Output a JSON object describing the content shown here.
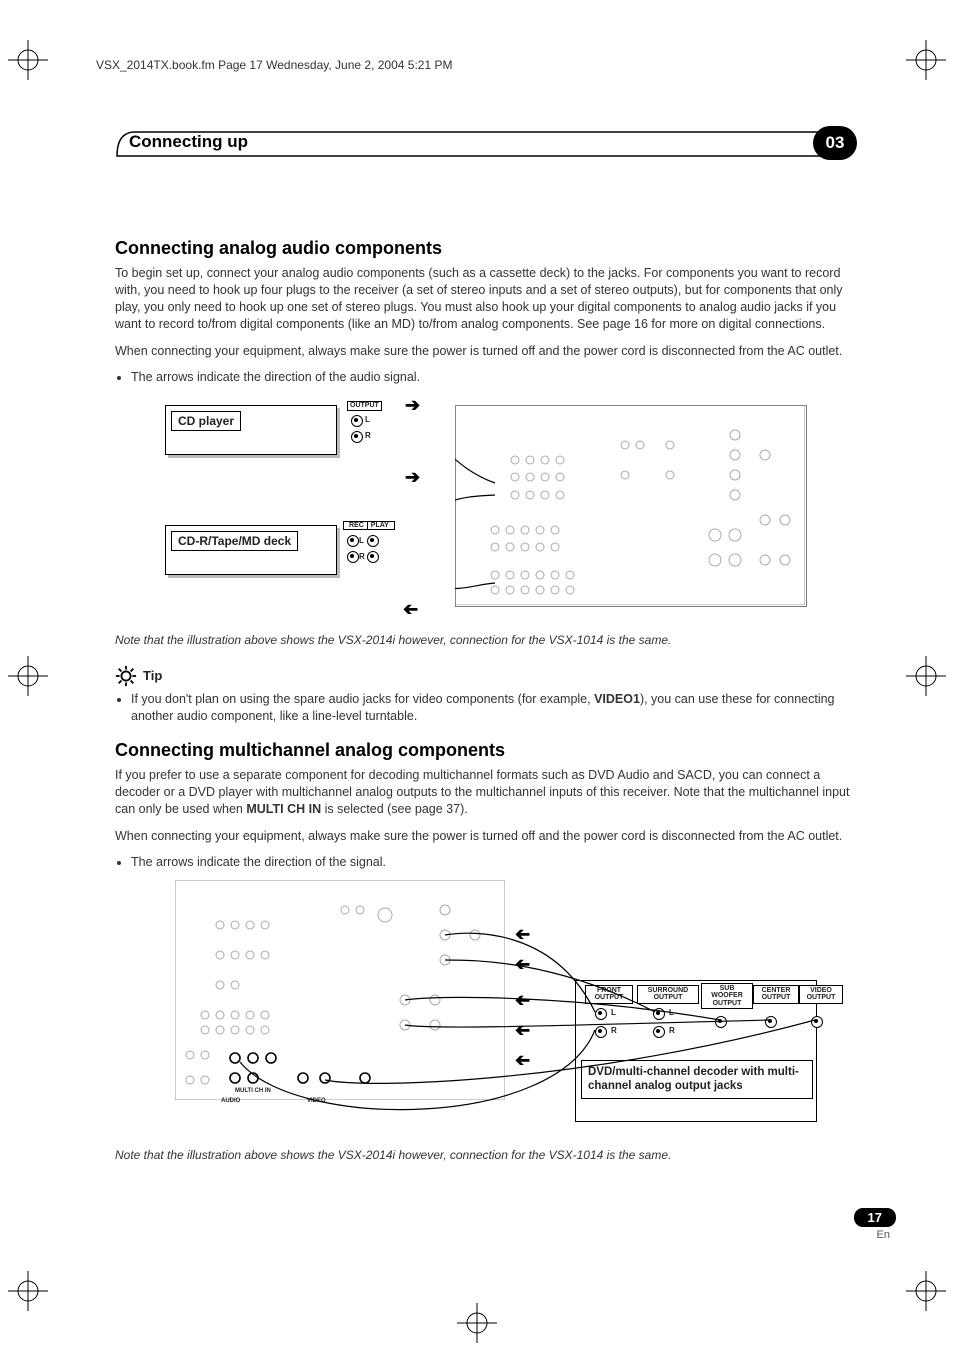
{
  "header": {
    "filepath_line": "VSX_2014TX.book.fm  Page 17  Wednesday, June 2, 2004  5:21 PM"
  },
  "chapter": {
    "title": "Connecting up",
    "number": "03"
  },
  "section1": {
    "heading": "Connecting analog audio components",
    "para1": "To begin set up, connect your analog audio components (such as a cassette deck) to the jacks. For components you want to record with, you need to hook up four plugs to the receiver (a set of stereo inputs and a set of stereo outputs), but for components that only play, you only need to hook up one set of stereo plugs. You must also hook up your digital components to analog audio jacks if you want to record to/from digital components (like an MD) to/from analog components. See page 16 for more on digital connections.",
    "para2": "When connecting your equipment, always make sure the power is turned off and the power cord is disconnected from the AC outlet.",
    "bullet1": "The arrows indicate the direction of the audio signal.",
    "fig": {
      "cd_label": "CD player",
      "cd_output": "OUTPUT",
      "cdr_label": "CD-R/Tape/MD deck",
      "cdr_rec": "REC",
      "cdr_play": "PLAY",
      "l": "L",
      "r": "R"
    },
    "caption": "Note that the illustration above shows the VSX-2014i however, connection for the VSX-1014 is the same."
  },
  "tip": {
    "label": "Tip",
    "text_before": "If you don't plan on using the spare audio jacks for video components (for example, ",
    "bold": "VIDEO1",
    "text_after": "), you can use these for connecting another audio component, like a line-level turntable."
  },
  "section2": {
    "heading": "Connecting multichannel analog components",
    "para1_before": "If you prefer to use a separate component for decoding multichannel formats such as DVD Audio and SACD, you can connect a decoder or a DVD player with multichannel analog outputs to the multichannel inputs of this receiver. Note that the multichannel input can only be used when ",
    "para1_bold": "MULTI CH IN",
    "para1_after": " is selected (see page 37).",
    "para2": "When connecting your equipment, always make sure the power is turned off and the power cord is disconnected from the AC outlet.",
    "bullet1": "The arrows indicate the direction of the signal.",
    "fig": {
      "decoder_label": "DVD/multi-channel decoder with multi-channel analog output jacks",
      "outputs": {
        "front": "FRONT OUTPUT",
        "surround": "SURROUND OUTPUT",
        "sub": "SUB WOOFER OUTPUT",
        "center": "CENTER OUTPUT",
        "video": "VIDEO OUTPUT"
      },
      "l": "L",
      "r": "R",
      "multi_ch": "MULTI CH IN",
      "audio": "AUDIO",
      "video": "VIDEO"
    },
    "caption": "Note that the illustration above shows the VSX-2014i however, connection for the VSX-1014 is the same."
  },
  "footer": {
    "page_number": "17",
    "lang": "En"
  }
}
